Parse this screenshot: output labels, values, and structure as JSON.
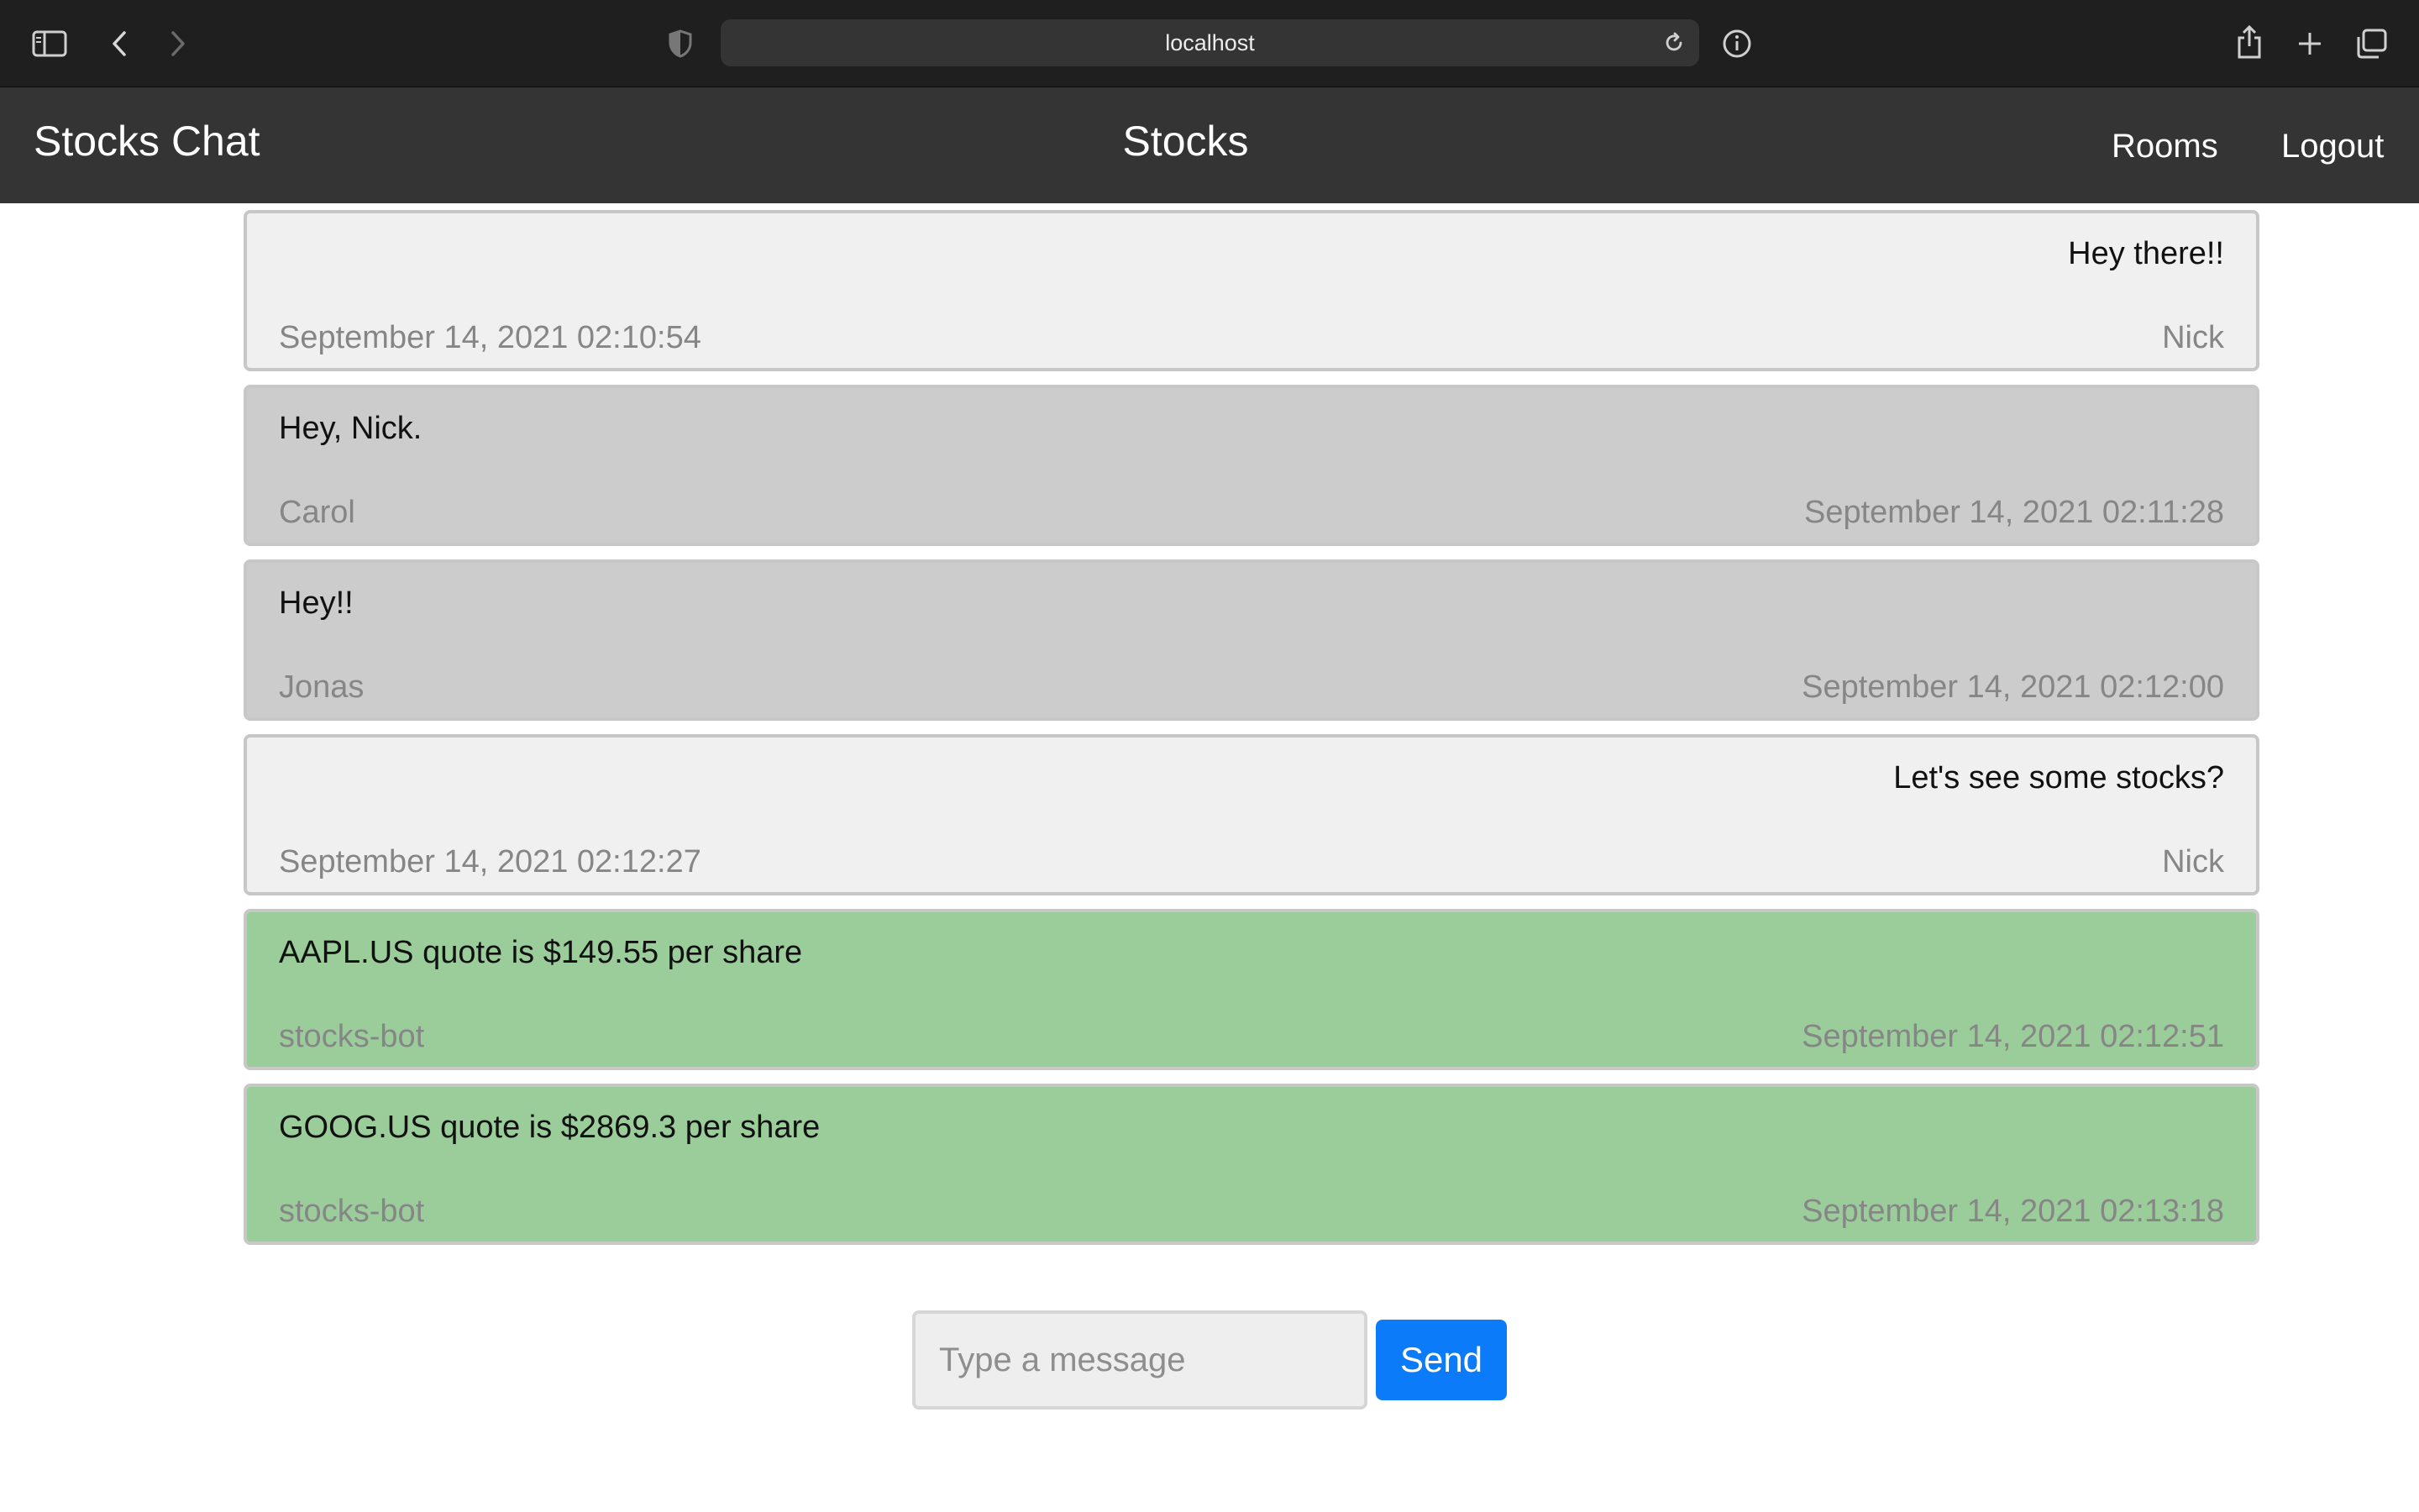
{
  "browser": {
    "url": "localhost",
    "icons": [
      "sidebar-icon",
      "back-icon",
      "forward-icon",
      "shield-icon",
      "reload-icon",
      "info-icon",
      "share-icon",
      "new-tab-icon",
      "tabs-overview-icon"
    ]
  },
  "navbar": {
    "brand": "Stocks Chat",
    "title": "Stocks",
    "links": [
      "Rooms",
      "Logout"
    ]
  },
  "messages": [
    {
      "kind": "own",
      "text": "Hey there!!",
      "timestamp": "September 14, 2021 02:10:54",
      "author": "Nick"
    },
    {
      "kind": "other",
      "text": "Hey, Nick.",
      "author": "Carol",
      "timestamp": "September 14, 2021 02:11:28"
    },
    {
      "kind": "other",
      "text": "Hey!!",
      "author": "Jonas",
      "timestamp": "September 14, 2021 02:12:00"
    },
    {
      "kind": "own",
      "text": "Let's see some stocks?",
      "timestamp": "September 14, 2021 02:12:27",
      "author": "Nick"
    },
    {
      "kind": "bot",
      "text": "AAPL.US quote is $149.55 per share",
      "author": "stocks-bot",
      "timestamp": "September 14, 2021 02:12:51"
    },
    {
      "kind": "bot",
      "text": "GOOG.US quote is $2869.3 per share",
      "author": "stocks-bot",
      "timestamp": "September 14, 2021 02:13:18"
    }
  ],
  "composer": {
    "placeholder": "Type a message",
    "value": "",
    "send_label": "Send"
  },
  "colors": {
    "navbar": "#343434",
    "own_message": "#f0f0f0",
    "other_message": "#cccccc",
    "bot_message": "#9bcd9b",
    "send_button": "#0b7bfa"
  }
}
